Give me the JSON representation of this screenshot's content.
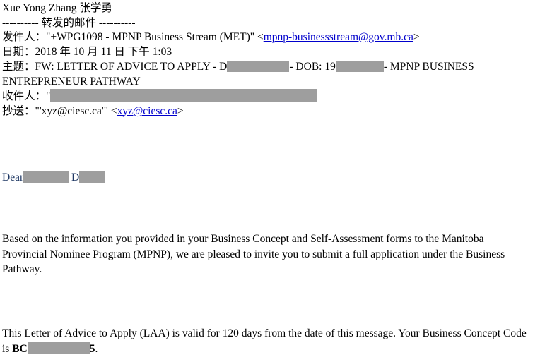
{
  "document": {
    "type": "forwarded-email-letter",
    "background_color": "#ffffff",
    "text_color": "#000000",
    "link_color": "#0000cc",
    "greeting_color": "#1f3864",
    "redaction_color": "#9e9e9e"
  },
  "header": {
    "sender_display_name": "Xue Yong Zhang 张学勇",
    "forward_separator": "---------- 转发的邮件 ----------",
    "from": {
      "label": "发件人：",
      "value": "\"+WPG1098 - MPNP Business Stream (MET)\" <",
      "email": "mpnp-businessstream@gov.mb.ca",
      "value_suffix": ">"
    },
    "date": {
      "label": "日期：",
      "value": "2018 年 10 月 11 日 下午 1:03"
    },
    "subject": {
      "label": "主题：",
      "part_1": "FW: LETTER OF ADVICE TO APPLY - D",
      "part_2": "- DOB: 19",
      "part_3": "- MPNP",
      "line_2": "BUSINESS ENTREPRENEUR PATHWAY"
    },
    "to": {
      "label": "收件人：",
      "value_prefix": "\""
    },
    "cc": {
      "label": "抄送：",
      "value_prefix": "\"'xyz@ciesc.ca'\"  <",
      "email": "xyz@ciesc.ca",
      "value_suffix": ">"
    }
  },
  "greeting": {
    "salutation": "Dear",
    "name_initial": "D"
  },
  "body": {
    "paragraph_1": "Based on the information you provided in your Business Concept and Self-Assessment  forms to the Manitoba Provincial Nominee Program (MPNP), we are pleased to invite you to submit a full application under the Business Pathway.",
    "paragraph_2_part_1": "This Letter of Advice to Apply (LAA) is valid for 120 days from the date of this message.  Your Business Concept Code is ",
    "paragraph_2_bold_prefix": "BC",
    "paragraph_2_bold_suffix": "5",
    "paragraph_2_end": "."
  }
}
